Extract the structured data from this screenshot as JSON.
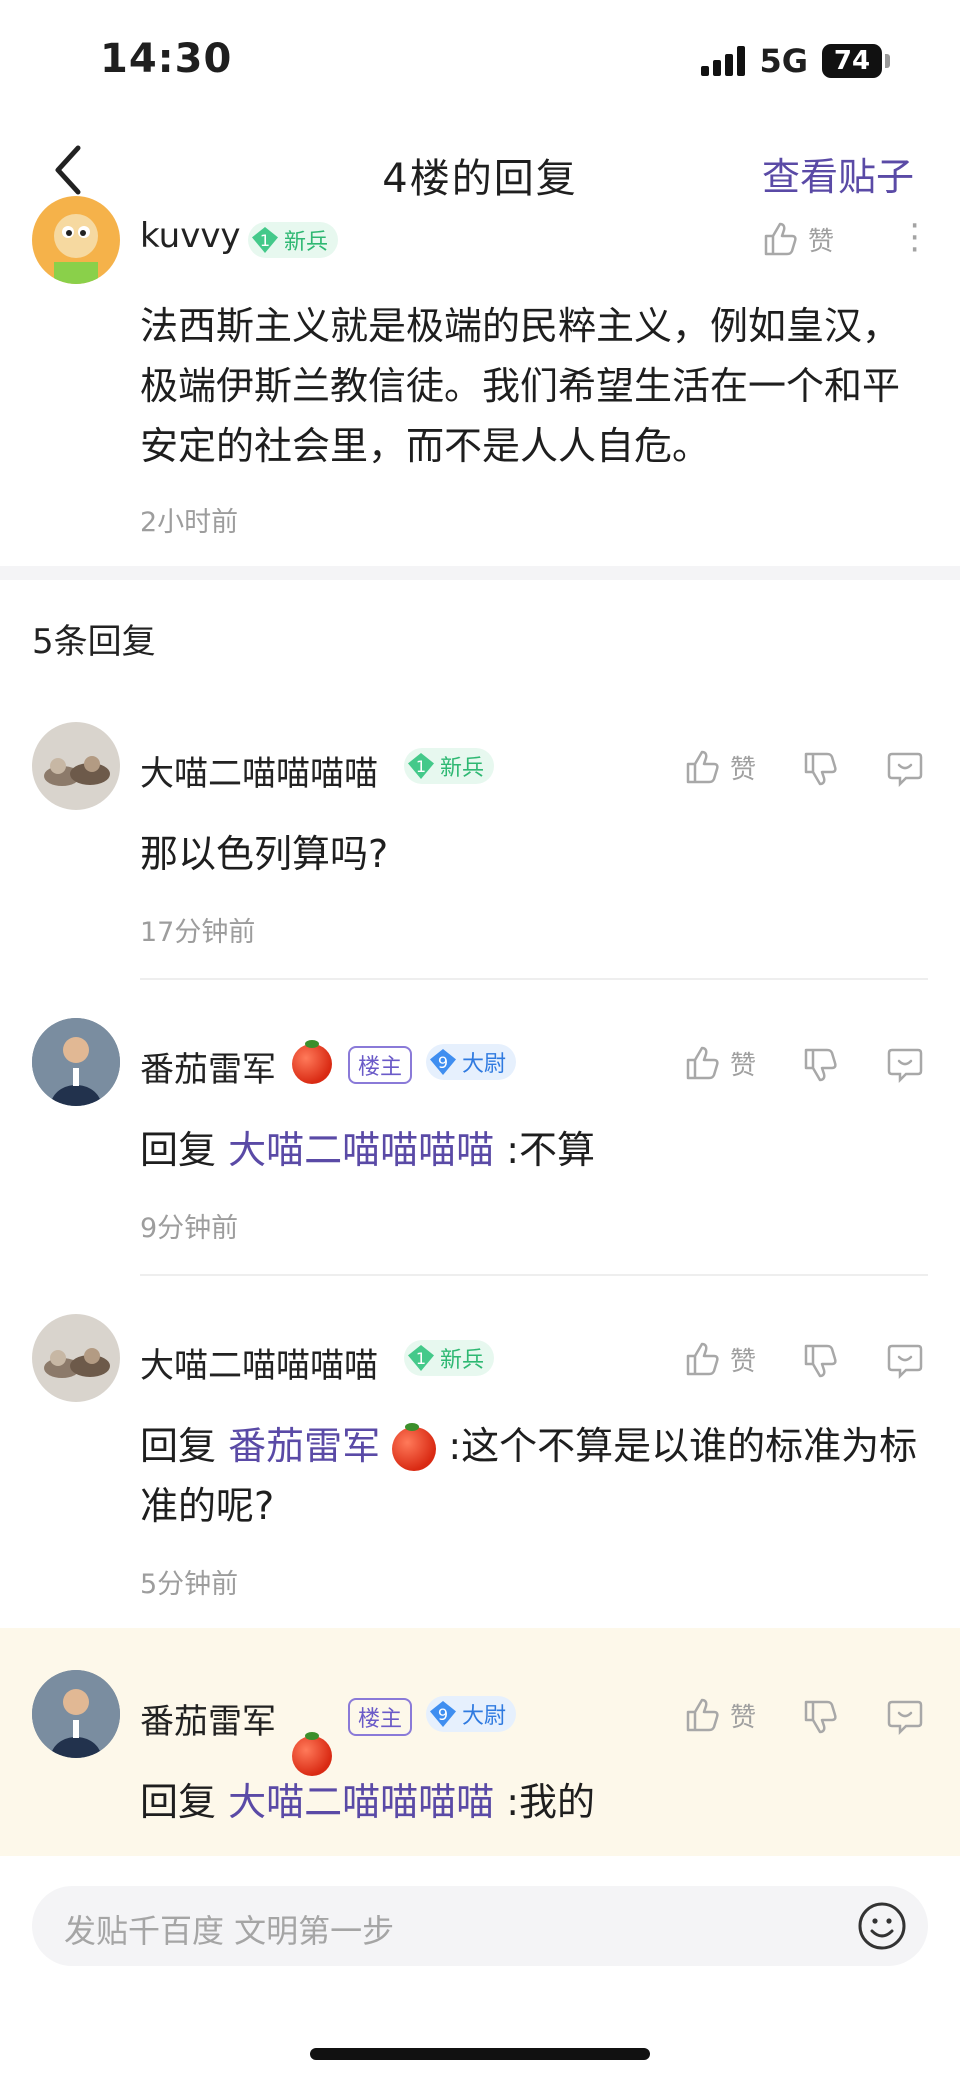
{
  "status_bar": {
    "time": "14:30",
    "network": "5G",
    "battery": "74"
  },
  "nav": {
    "title": "4楼的回复",
    "view_post": "查看贴子"
  },
  "post": {
    "username": "kuvvy",
    "level_num": "1",
    "level_name": "新兵",
    "like_label": "赞",
    "content": "法西斯主义就是极端的民粹主义，例如皇汉，极端伊斯兰教信徒。我们希望生活在一个和平安定的社会里，而不是人人自危。",
    "time": "2小时前"
  },
  "replies_header": "5条回复",
  "replies": [
    {
      "username": "大喵二喵喵喵喵",
      "level_num": "1",
      "level_name": "新兵",
      "text": "那以色列算吗?",
      "time": "17分钟前",
      "like_label": "赞"
    },
    {
      "username": "番茄雷军",
      "owner_badge": "楼主",
      "level_num": "9",
      "level_name": "大尉",
      "reply_prefix": "回复",
      "reply_to": "大喵二喵喵喵喵",
      "text": ":不算",
      "time": "9分钟前",
      "like_label": "赞"
    },
    {
      "username": "大喵二喵喵喵喵",
      "level_num": "1",
      "level_name": "新兵",
      "reply_prefix": "回复",
      "reply_to": "番茄雷军",
      "text": ":这个不算是以谁的标准为标准的呢?",
      "time": "5分钟前",
      "like_label": "赞"
    },
    {
      "username": "番茄雷军",
      "owner_badge": "楼主",
      "level_num": "9",
      "level_name": "大尉",
      "reply_prefix": "回复",
      "reply_to": "大喵二喵喵喵喵",
      "text": ":我的",
      "like_label": "赞"
    }
  ],
  "input": {
    "placeholder": "发贴千百度 文明第一步"
  },
  "colors": {
    "accent": "#5a4aa6",
    "highlight_bg": "#fdf8ea",
    "newbie_green": "#2fb873",
    "captain_blue": "#2f7ae0"
  }
}
